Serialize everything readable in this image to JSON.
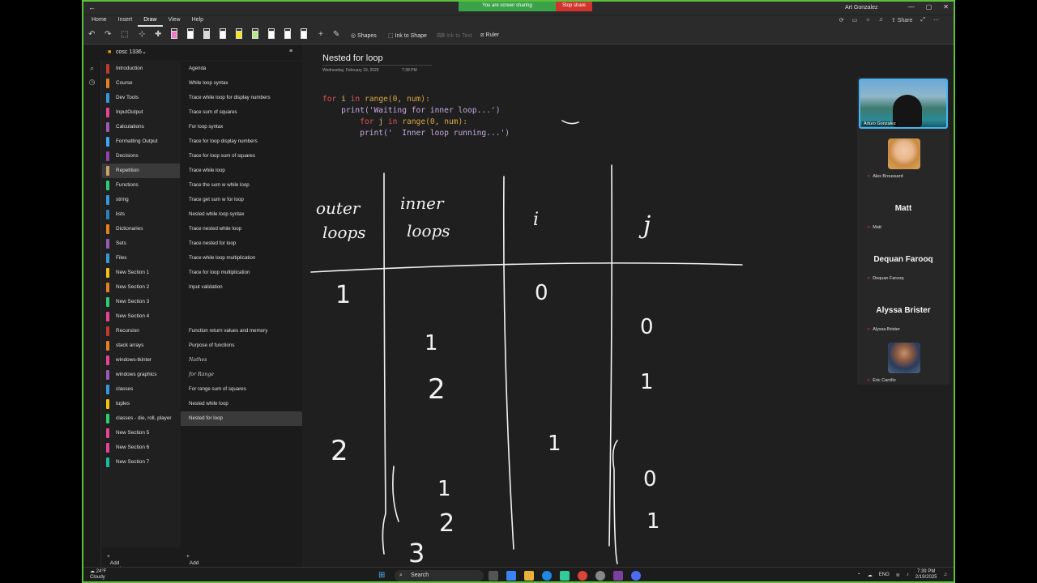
{
  "titlebar": {
    "share_status": "You are screen sharing",
    "stop_share": "Stop share",
    "user_name": "Art Gonzalez"
  },
  "menu": {
    "tabs": [
      "Home",
      "Insert",
      "Draw",
      "View",
      "Help"
    ],
    "active": "Draw",
    "share_label": "Share"
  },
  "ribbon": {
    "shapes": "Shapes",
    "ink_to_shape": "Ink to Shape",
    "ink_to_text": "Ink to Text",
    "ruler": "Ruler",
    "pen_colors": [
      "#f07ac8",
      "#ffffff",
      "#d8d8d8",
      "#ffffff",
      "#f5e61a",
      "#b8e986",
      "#ffffff",
      "#ffffff",
      "#ffffff"
    ]
  },
  "notebook": {
    "name": "cosc 1336"
  },
  "sections": [
    {
      "label": "Introduction",
      "color": "#c0392b"
    },
    {
      "label": "Course",
      "color": "#e67e22"
    },
    {
      "label": "Dev Tools",
      "color": "#3498db"
    },
    {
      "label": "InputOutput",
      "color": "#e84393"
    },
    {
      "label": "Calculations",
      "color": "#9b59b6"
    },
    {
      "label": "Formatting Output",
      "color": "#3da5f4"
    },
    {
      "label": "Decisions",
      "color": "#8e44ad"
    },
    {
      "label": "Repetition",
      "color": "#c9a26b"
    },
    {
      "label": "Functions",
      "color": "#2ecc71"
    },
    {
      "label": "string",
      "color": "#3498db"
    },
    {
      "label": "lists",
      "color": "#2980b9"
    },
    {
      "label": "Dictionaries",
      "color": "#e67e22"
    },
    {
      "label": "Sets",
      "color": "#9b59b6"
    },
    {
      "label": "Files",
      "color": "#3498db"
    },
    {
      "label": "New Section 1",
      "color": "#f1c40f"
    },
    {
      "label": "New Section 2",
      "color": "#e67e22"
    },
    {
      "label": "New Section 3",
      "color": "#2ecc71"
    },
    {
      "label": "New Section 4",
      "color": "#e84393"
    },
    {
      "label": "Recursion",
      "color": "#c0392b"
    },
    {
      "label": "stack arrays",
      "color": "#e67e22"
    },
    {
      "label": "windows-tkinter",
      "color": "#e84393"
    },
    {
      "label": "windows graphics",
      "color": "#9b59b6"
    },
    {
      "label": "classes",
      "color": "#3498db"
    },
    {
      "label": "tuples",
      "color": "#f1c40f"
    },
    {
      "label": "classes - die, roll, player",
      "color": "#2ecc71"
    },
    {
      "label": "New Section 5",
      "color": "#e84393"
    },
    {
      "label": "New Section 6",
      "color": "#e84393"
    },
    {
      "label": "New Section 7",
      "color": "#1abc9c"
    }
  ],
  "selected_section": "Repetition",
  "pages": [
    {
      "label": "Agenda"
    },
    {
      "label": "While loop syntax"
    },
    {
      "label": "Trace while loop for display numbers"
    },
    {
      "label": "Trace sum of squares"
    },
    {
      "label": "For loop syntax"
    },
    {
      "label": "Trace for loop display numbers"
    },
    {
      "label": "Trace for loop sum of squares"
    },
    {
      "label": "Trace while loop"
    },
    {
      "label": "Trace the sum w while loop"
    },
    {
      "label": "Trace get sum w for loop"
    },
    {
      "label": "Nested while loop syntax"
    },
    {
      "label": "Trace nested while loop"
    },
    {
      "label": "Trace nested for loop"
    },
    {
      "label": "Trace while loop multiplication"
    },
    {
      "label": "Trace for loop multiplication"
    },
    {
      "label": "Input validation"
    },
    {
      "label": ""
    },
    {
      "label": "",
      "ink": true
    },
    {
      "label": "Function return values and memory"
    },
    {
      "label": "Purpose of functions"
    },
    {
      "label": "Nathes",
      "ink": true
    },
    {
      "label": "for Range",
      "ink": true
    },
    {
      "label": "For range sum of squares"
    },
    {
      "label": "Nested while loop"
    },
    {
      "label": "Nested for loop"
    }
  ],
  "selected_page": "Nested for loop",
  "footer": {
    "add_section": "Add section",
    "add_page": "Add page"
  },
  "page": {
    "title": "Nested for loop",
    "date": "Wednesday, February 19, 2025",
    "time": "7:38 PM",
    "code": {
      "line1_kw": "for",
      "line1_var": " i ",
      "line1_in": "in",
      "line1_rest": " range(0, num):",
      "line2": "    print('Waiting for inner loop...')",
      "line3_kw": "for",
      "line3_var": " j ",
      "line3_in": "in",
      "line3_rest": " range(0, num):",
      "line4": "        print('  Inner loop running...')"
    }
  },
  "participants": [
    {
      "name": "Arturo Gonzalez",
      "kind": "video"
    },
    {
      "name": "Alex Broussard",
      "kind": "photo"
    },
    {
      "name": "Matt",
      "display": "Matt",
      "kind": "text"
    },
    {
      "name": "Dequan Farooq",
      "display": "Dequan Farooq",
      "kind": "text"
    },
    {
      "name": "Alyssa Brister",
      "display": "Alyssa Brister",
      "kind": "text"
    },
    {
      "name": "Eric Carrillo",
      "kind": "photo"
    }
  ],
  "taskbar": {
    "temp": "24°F",
    "weather": "Cloudy",
    "search": "Search",
    "lang": "ENG",
    "time": "7:39 PM",
    "date": "2/19/2025"
  }
}
